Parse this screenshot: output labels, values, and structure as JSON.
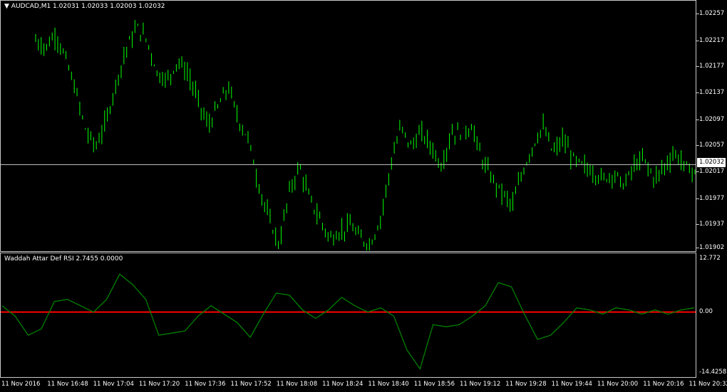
{
  "header": {
    "symbol_title": "AUDCAD,M1  1.02031 1.02033 1.02003 1.02032",
    "dropdown_icon": "triangle-down-icon"
  },
  "indicator": {
    "title": "Waddah Attar Def RSI 2.7455 0.0000",
    "scale_max": "12.772",
    "scale_zero": "0.00",
    "scale_min": "-14.4258"
  },
  "price_axis": {
    "ticks": [
      "1.02257",
      "1.02217",
      "1.02177",
      "1.02137",
      "1.02097",
      "1.02057",
      "1.02017",
      "1.01977",
      "1.01937",
      "1.01902"
    ],
    "bid_label": "1.02032"
  },
  "time_axis": {
    "labels": [
      "11 Nov 2016",
      "11 Nov 16:48",
      "11 Nov 17:04",
      "11 Nov 17:20",
      "11 Nov 17:36",
      "11 Nov 17:52",
      "11 Nov 18:08",
      "11 Nov 18:24",
      "11 Nov 18:40",
      "11 Nov 18:56",
      "11 Nov 19:12",
      "11 Nov 19:28",
      "11 Nov 19:44",
      "11 Nov 20:00",
      "11 Nov 20:16",
      "11 Nov 20:32"
    ]
  },
  "colors": {
    "background": "#000000",
    "bars": "#00ff00",
    "indicator_line": "#008000",
    "zero_line": "#ff0000",
    "grid": "#c8c8c8"
  },
  "chart_data": [
    {
      "type": "line",
      "series": [
        {
          "values": [
            1.0222,
            1.0221,
            1.0223,
            1.0219,
            1.0214,
            1.0208,
            1.0206,
            1.021,
            1.0216,
            1.0221,
            1.0224,
            1.0222,
            1.0217,
            1.0216,
            1.0219,
            1.0217,
            1.0213,
            1.0209,
            1.0212,
            1.0215,
            1.021,
            1.0207,
            1.02,
            1.0195,
            1.0191,
            1.0199,
            1.0203,
            1.0198,
            1.0195,
            1.0192,
            1.0193,
            1.0194,
            1.0192,
            1.0191,
            1.0195,
            1.0203,
            1.0209,
            1.0206,
            1.0208,
            1.0206,
            1.0203,
            1.0208,
            1.0208,
            1.0209,
            1.0204,
            1.0201,
            1.0199,
            1.0197,
            1.0202,
            1.0206,
            1.0209,
            1.0205,
            1.0207,
            1.0204,
            1.0203,
            1.0202,
            1.0201,
            1.0202,
            1.02,
            1.0203,
            1.0204,
            1.0201,
            1.0203,
            1.0205,
            1.0203,
            1.0202
          ]
        }
      ],
      "ylim": [
        1.01902,
        1.02275
      ]
    },
    {
      "type": "line",
      "series": [
        {
          "values": [
            1.5,
            -1.0,
            -5.5,
            -4.0,
            2.5,
            3.0,
            1.5,
            0,
            3.0,
            9.0,
            6.5,
            3.0,
            -5.5,
            -5.0,
            -4.5,
            -1.0,
            1.5,
            -0.5,
            -2.5,
            -6.0,
            -0.5,
            4.5,
            4.0,
            0.5,
            -1.5,
            0.5,
            3.5,
            1.5,
            0,
            1.0,
            -1.0,
            -9.0,
            -13.5,
            -3.0,
            -3.5,
            -3.0,
            -1.0,
            1.5,
            7.0,
            6.0,
            -0.5,
            -6.5,
            -5.5,
            -2.5,
            1.0,
            0.5,
            -0.5,
            1.0,
            0.5,
            -0.5,
            0.5,
            -0.5,
            0.5,
            1.0
          ]
        }
      ],
      "ylim": [
        -14.4258,
        12.772
      ]
    }
  ]
}
